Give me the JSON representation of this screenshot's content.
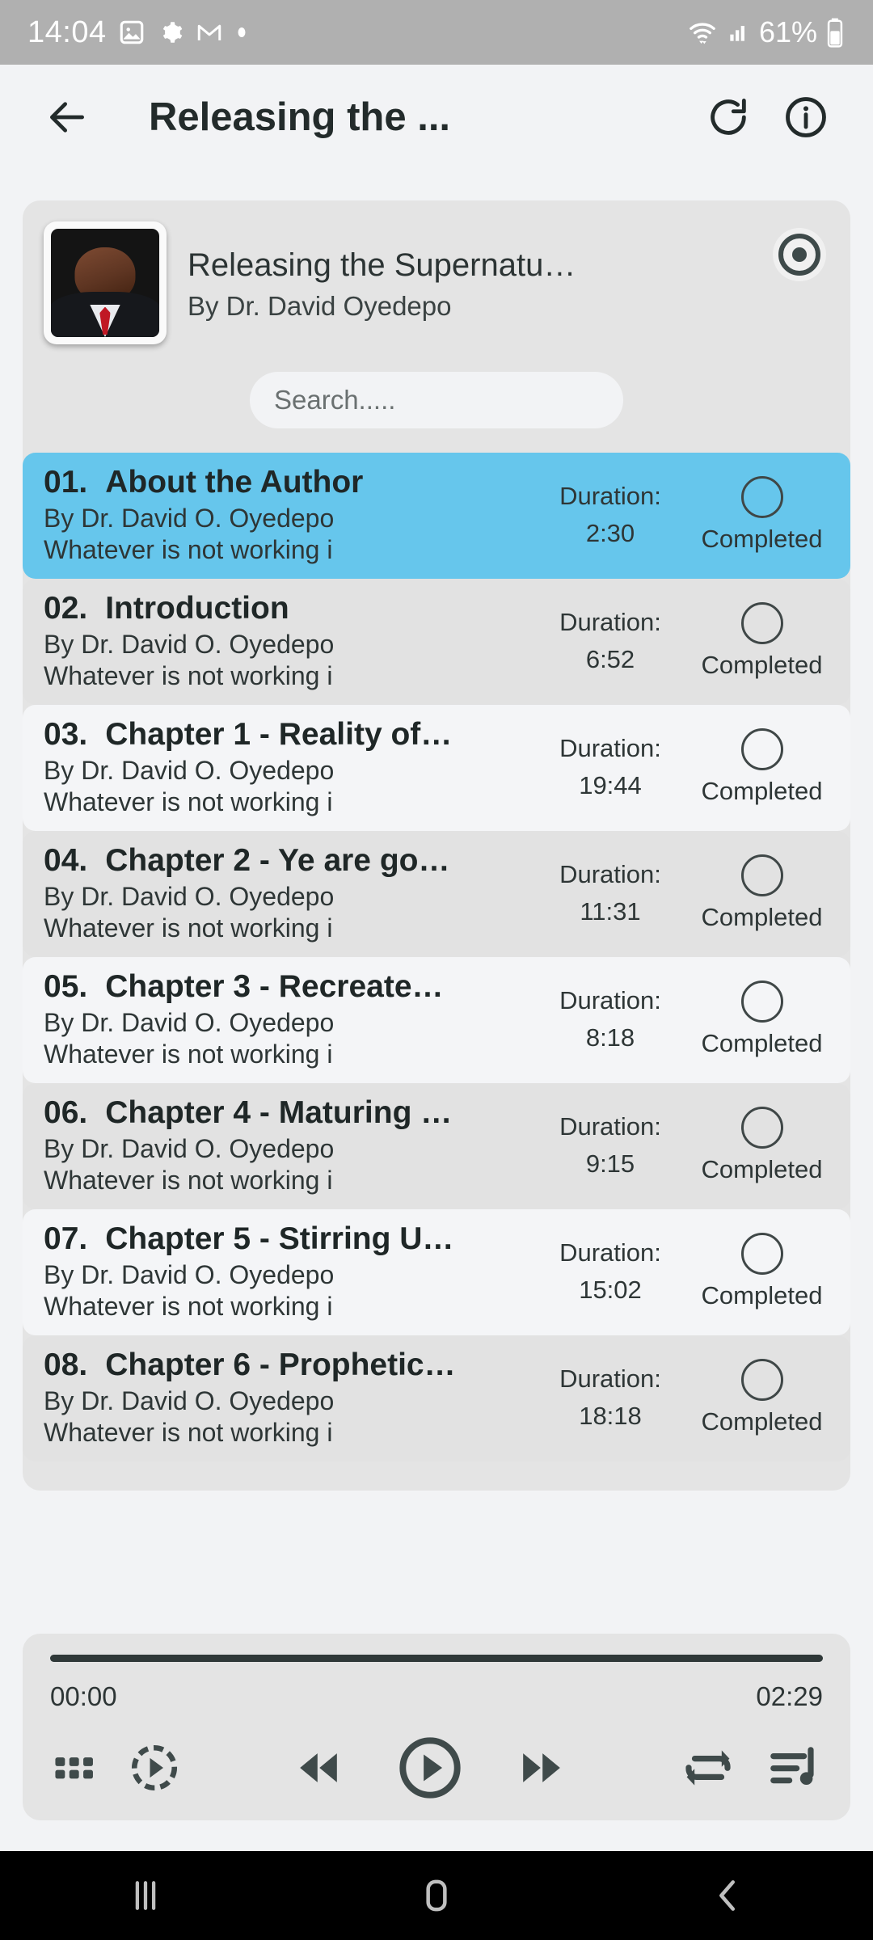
{
  "status_bar": {
    "time": "14:04",
    "battery_percent": "61%",
    "icons": [
      "photos-icon",
      "gear-icon",
      "gmail-icon",
      "dot-icon",
      "wifi-icon",
      "cellular-signal-icon",
      "battery-icon"
    ]
  },
  "app_bar": {
    "title": "Releasing the ...",
    "back_icon": "back-arrow-icon",
    "refresh_icon": "refresh-icon",
    "info_icon": "info-icon"
  },
  "book": {
    "title": "Releasing the Supernatu…",
    "author": "By Dr. David Oyedepo",
    "cover_alt": "book-cover-portrait",
    "record_icon": "record-icon"
  },
  "search": {
    "placeholder": "Search.....",
    "value": ""
  },
  "tracks_meta": {
    "duration_label": "Duration:",
    "status_label": "Completed"
  },
  "tracks": [
    {
      "num": "01.",
      "name": "About the Author",
      "author": "By Dr. David O. Oyedepo",
      "desc": "Whatever is not working i",
      "duration": "2:30",
      "status": "Completed",
      "active": true
    },
    {
      "num": "02.",
      "name": "Introduction",
      "author": "By Dr. David O. Oyedepo",
      "desc": "Whatever is not working i",
      "duration": "6:52",
      "status": "Completed",
      "active": false
    },
    {
      "num": "03.",
      "name": "Chapter 1 - Reality of…",
      "author": "By Dr. David O. Oyedepo",
      "desc": "Whatever is not working i",
      "duration": "19:44",
      "status": "Completed",
      "active": false
    },
    {
      "num": "04.",
      "name": "Chapter 2 - Ye are go…",
      "author": "By Dr. David O. Oyedepo",
      "desc": "Whatever is not working i",
      "duration": "11:31",
      "status": "Completed",
      "active": false
    },
    {
      "num": "05.",
      "name": "Chapter 3 - Recreate…",
      "author": "By Dr. David O. Oyedepo",
      "desc": "Whatever is not working i",
      "duration": "8:18",
      "status": "Completed",
      "active": false
    },
    {
      "num": "06.",
      "name": "Chapter 4 - Maturing …",
      "author": "By Dr. David O. Oyedepo",
      "desc": "Whatever is not working i",
      "duration": "9:15",
      "status": "Completed",
      "active": false
    },
    {
      "num": "07.",
      "name": "Chapter 5 - Stirring U…",
      "author": "By Dr. David O. Oyedepo",
      "desc": "Whatever is not working i",
      "duration": "15:02",
      "status": "Completed",
      "active": false
    },
    {
      "num": "08.",
      "name": "Chapter 6 - Prophetic…",
      "author": "By Dr. David O. Oyedepo",
      "desc": "Whatever is not working i",
      "duration": "18:18",
      "status": "Completed",
      "active": false
    }
  ],
  "player": {
    "elapsed": "00:00",
    "total": "02:29",
    "progress_percent": 0,
    "controls": [
      "grid-icon",
      "playback-speed-icon",
      "rewind-icon",
      "play-icon",
      "fast-forward-icon",
      "repeat-icon",
      "queue-icon"
    ]
  },
  "nav_bar": {
    "recents_icon": "recents-icon",
    "home_icon": "home-icon",
    "back_icon": "nav-back-icon"
  },
  "colors": {
    "accent": "#66c6ec",
    "status_bar": "#b0b0b0",
    "page_bg": "#f2f3f5",
    "card_bg": "#e4e4e4",
    "row_odd": "#f4f5f7",
    "row_even": "#e2e2e2",
    "text_primary": "#1f2727"
  }
}
